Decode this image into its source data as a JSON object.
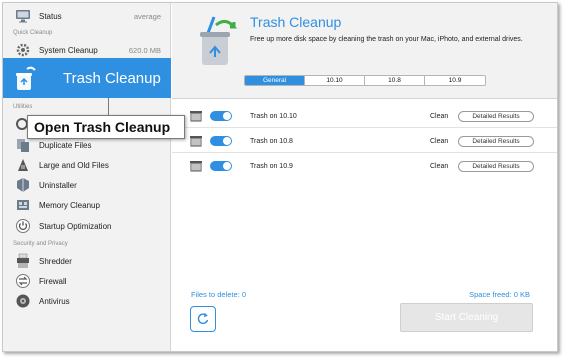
{
  "sidebar": {
    "top_item": {
      "label": "Status",
      "value": "average"
    },
    "section_quick_cleanup": "Quick Cleanup",
    "system_cleanup": {
      "label": "System Cleanup",
      "value": "620.0 MB"
    },
    "trash_cleanup": {
      "label": "Trash Cleanup"
    },
    "section_utilities": "Utilities",
    "items_utilities": [
      {
        "label": "Duplicate Files",
        "icon": "duplicate-files-icon"
      },
      {
        "label": "Large and Old Files",
        "icon": "large-files-icon"
      },
      {
        "label": "Uninstaller",
        "icon": "uninstaller-icon"
      },
      {
        "label": "Memory Cleanup",
        "icon": "memory-icon"
      },
      {
        "label": "Startup Optimization",
        "icon": "power-icon"
      }
    ],
    "section_security": "Security and Privacy",
    "items_security": [
      {
        "label": "Shredder",
        "icon": "shredder-icon"
      },
      {
        "label": "Firewall",
        "icon": "firewall-icon"
      },
      {
        "label": "Antivirus",
        "icon": "antivirus-icon"
      }
    ]
  },
  "callout": {
    "text": "Open Trash Cleanup"
  },
  "header": {
    "title": "Trash Cleanup",
    "description": "Free up more disk space by cleaning the trash on your Mac, iPhoto, and external drives."
  },
  "tabs": [
    {
      "label": "General",
      "active": true
    },
    {
      "label": "10.10",
      "active": false
    },
    {
      "label": "10.8",
      "active": false
    },
    {
      "label": "10.9",
      "active": false
    }
  ],
  "rows": [
    {
      "label": "Trash on 10.10",
      "status": "Clean",
      "button": "Detailed Results"
    },
    {
      "label": "Trash on 10.8",
      "status": "Clean",
      "button": "Detailed Results"
    },
    {
      "label": "Trash on 10.9",
      "status": "Clean",
      "button": "Detailed Results"
    }
  ],
  "footer": {
    "files_to_delete": "Files to delete: 0",
    "space_freed": "Space freed: 0 KB",
    "start_button": "Start Cleaning"
  },
  "colors": {
    "accent": "#2f8fe0",
    "sidebar_bg": "#f2f2f2"
  }
}
